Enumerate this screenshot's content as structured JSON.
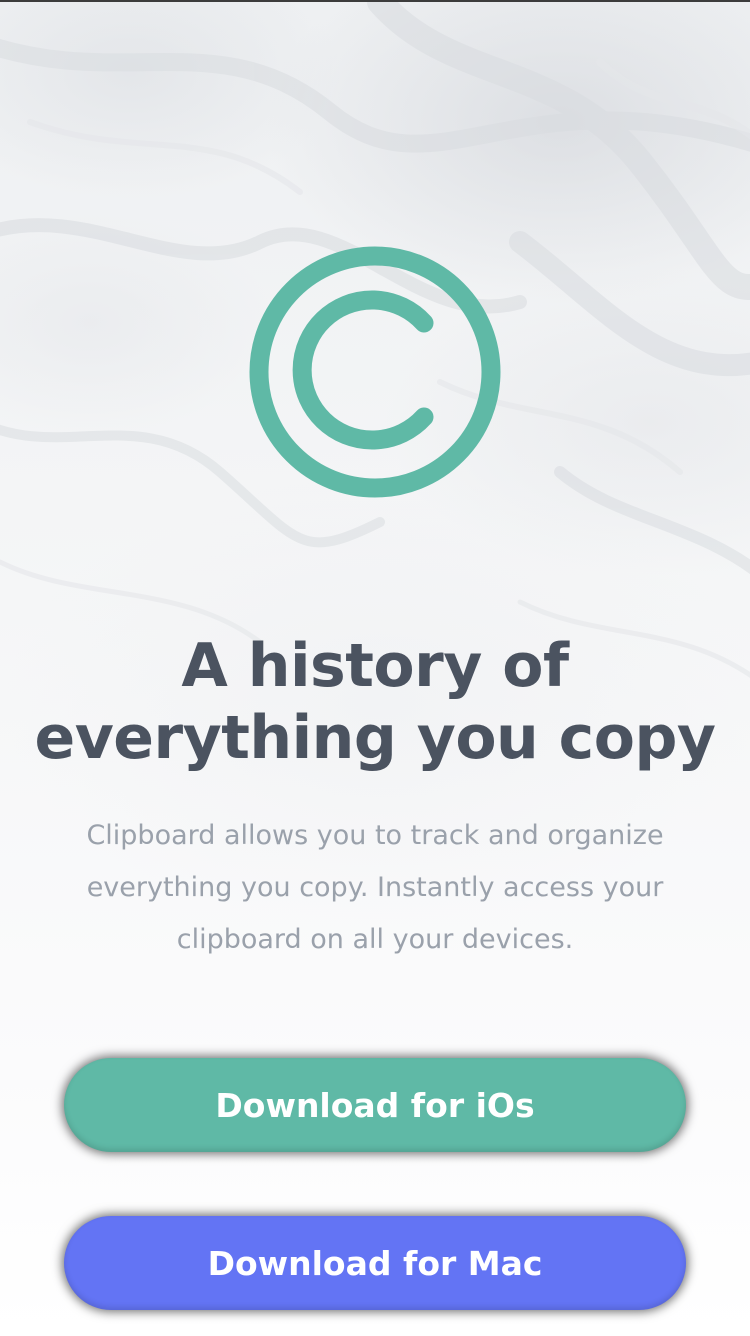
{
  "hero": {
    "logo_icon": "copyright-c-icon",
    "headline": "A history of\neverything you copy",
    "description": "Clipboard allows you to track and organize everything you copy. Instantly access your clipboard on all your devices."
  },
  "actions": {
    "ios_label": "Download for iOs",
    "mac_label": "Download for Mac"
  },
  "colors": {
    "accent_teal": "#5fb9a6",
    "accent_blue": "#6374f4",
    "heading": "#4b5360",
    "body_text": "#9aa1ab"
  }
}
